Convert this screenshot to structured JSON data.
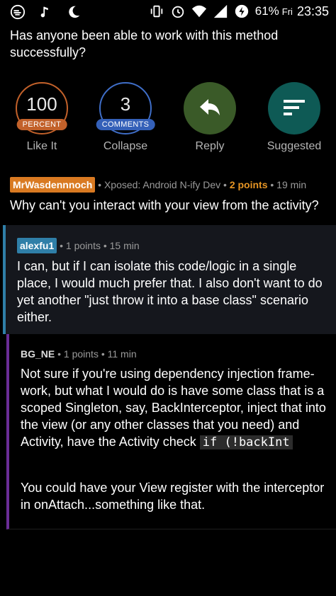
{
  "status_bar": {
    "battery": "61%",
    "day": "Fri",
    "time": "23:35"
  },
  "post": {
    "title": "Has anyone been able to work with this method successfully?"
  },
  "actions": {
    "like": {
      "value": "100",
      "badge": "PERCENT",
      "label": "Like It"
    },
    "comments": {
      "value": "3",
      "badge": "COMMENTS",
      "label": "Collapse"
    },
    "reply": {
      "label": "Reply"
    },
    "suggested": {
      "label": "Suggested"
    }
  },
  "comments": [
    {
      "author": "MrWasdennnoch",
      "flair": " • Xposed: Android N-ify Dev • ",
      "points": "2 points",
      "time": " • 19 min",
      "body": "Why can't you interact with your view from the activity?"
    },
    {
      "author": "alexfu1",
      "meta": " • 1 points • 15 min",
      "body": "I can, but if I can isolate this code/logic in a single place, I would much prefer that. I also don't want to do yet another \"just throw it into a base class\" scenario either."
    },
    {
      "author": "BG_NE",
      "meta": " • 1 points • 11 min",
      "body_part1": "Not sure if you're using dependency injection frame-work, but what I would do is have some class that is a scoped Singleton, say, BackInterceptor, inject that into the view (or any other classes that you need) and Activity, have the Activity check ",
      "code": "if (!backInt",
      "body_part2": "You could have your View register with the interceptor in onAttach...something like that."
    }
  ],
  "colors": {
    "like_ring": "#c2612a",
    "comments_ring": "#3f6ec8",
    "reply_bg": "#3a5a28",
    "suggested_bg": "#0e5a55",
    "reply1_bar": "#2f7fa8",
    "reply2_bar": "#6a2d96"
  },
  "icons": [
    "app-icon",
    "music-icon",
    "moon-icon",
    "vibrate-icon",
    "alarm-icon",
    "wifi-icon",
    "signal-icon",
    "battery-icon",
    "reply-arrow-icon",
    "suggested-lines-icon"
  ]
}
